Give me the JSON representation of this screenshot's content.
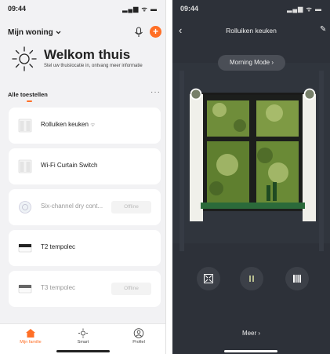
{
  "left": {
    "status": {
      "time": "09:44",
      "icons": "▂▄▆ ᯤ ▬"
    },
    "home_title": "Mijn woning",
    "welcome": "Welkom thuis",
    "subtitle": "Stel uw thuislocatie in, ontvang meer informatie",
    "section": "Alle toestellen",
    "more_dots": "···",
    "devices": [
      {
        "name": "Rolluiken keuken",
        "suffix": "ᯤ",
        "status": ""
      },
      {
        "name": "Wi-Fi Curtain Switch",
        "suffix": "",
        "status": ""
      },
      {
        "name": "Six-channel dry cont...",
        "suffix": "",
        "status": "Offline"
      },
      {
        "name": "T2 tempolec",
        "suffix": "",
        "status": ""
      },
      {
        "name": "T3 tempolec",
        "suffix": "",
        "status": "Offline"
      }
    ],
    "tabs": [
      {
        "label": "Mijn familie"
      },
      {
        "label": "Smart"
      },
      {
        "label": "Profiel"
      }
    ],
    "accent": "#ff6f26"
  },
  "right": {
    "status": {
      "time": "09:44",
      "icons": "▂▄▆ ᯤ ▬"
    },
    "back": "‹",
    "title": "Rolluiken keuken",
    "edit": "✎",
    "scene": "Morning Mode ›",
    "more": "Meer ›",
    "controls": [
      "open-icon",
      "pause-icon",
      "close-icon"
    ]
  }
}
